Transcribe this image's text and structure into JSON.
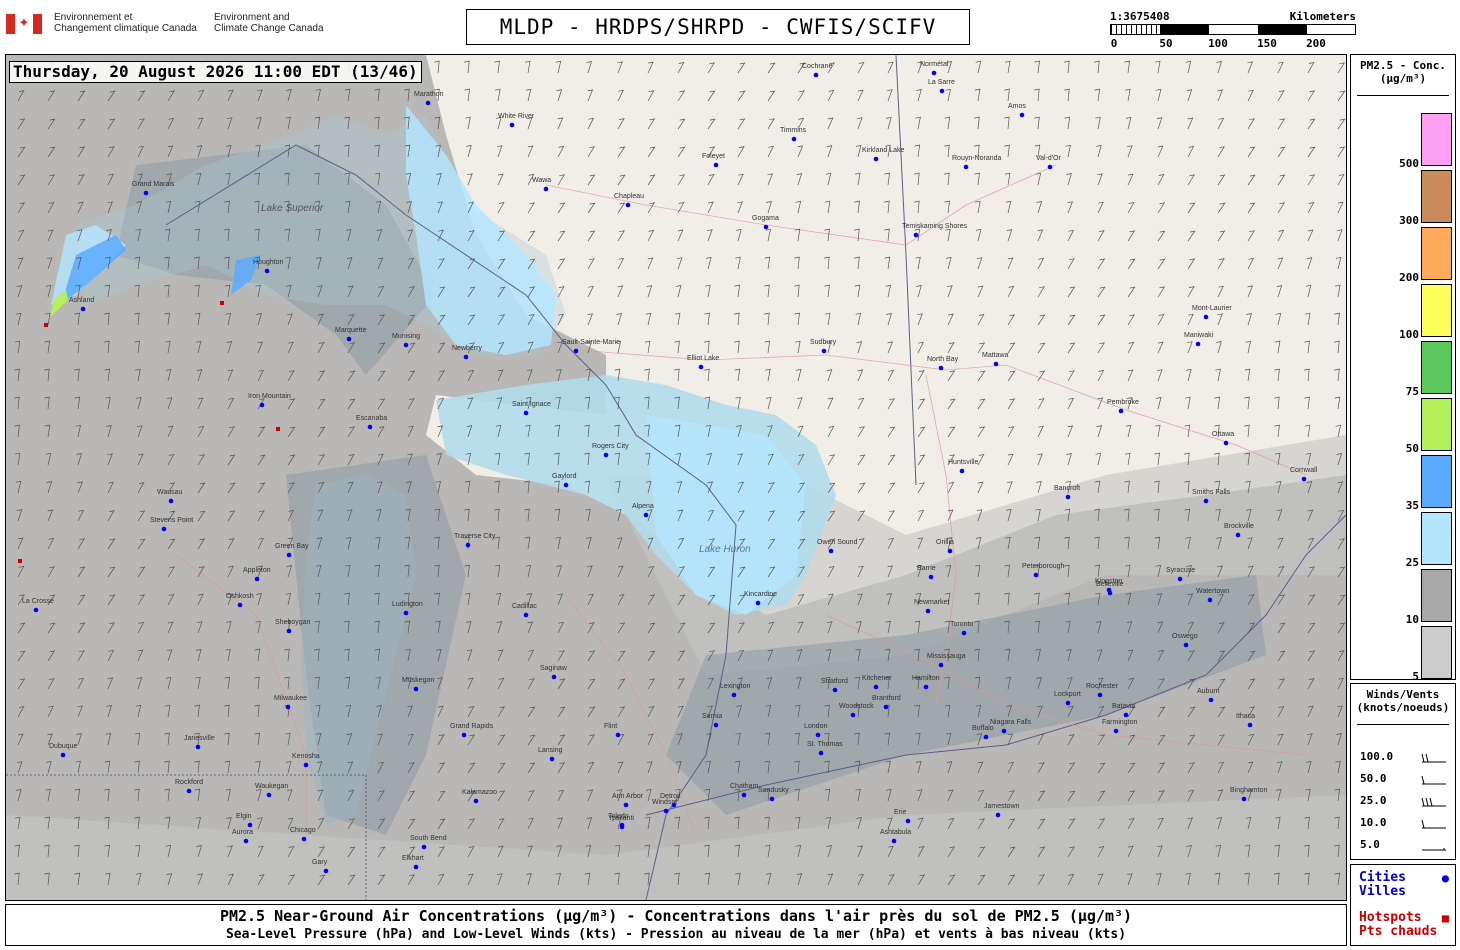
{
  "header": {
    "dept_fr_line1": "Environnement et",
    "dept_fr_line2": "Changement climatique Canada",
    "dept_en_line1": "Environment and",
    "dept_en_line2": "Climate Change Canada",
    "title": "MLDP - HRDPS/SHRPD - CWFIS/SCIFV",
    "scale_ratio": "1:3675408",
    "scale_unit": "Kilometers",
    "scale_ticks": [
      "0",
      "50",
      "100",
      "150",
      "200"
    ]
  },
  "map": {
    "timestamp": "Thursday, 20 August 2026 11:00 EDT (13/46)",
    "lake_labels": [
      "Lake Superior",
      "Lake Huron"
    ],
    "cities": [
      "Cochrane",
      "Normétal",
      "La Sarre",
      "Amos",
      "Val-d'Or",
      "Rouyn-Noranda",
      "Kirkland Lake",
      "Timmins",
      "Foleyet",
      "White River",
      "Marathon",
      "Wawa",
      "Chapleau",
      "Gogama",
      "Temiskaming Shores",
      "Sault-Sainte-Marie",
      "Elliot Lake",
      "Sudbury",
      "North Bay",
      "Mattawa",
      "Maniwaki",
      "Mont-Laurier",
      "Pembroke",
      "Ottawa",
      "Cornwall",
      "Huntsville",
      "Bancroft",
      "Smiths Falls",
      "Brockville",
      "Orillia",
      "Barrie",
      "Peterborough",
      "Belleville",
      "Newmarket",
      "Toronto",
      "Mississauga",
      "Hamilton",
      "Owen Sound",
      "Kincardine",
      "Stratford",
      "Kitchener",
      "Brantford",
      "Woodstock",
      "London",
      "St. Thomas",
      "Chatham",
      "Sarnia",
      "Detroit",
      "Windsor",
      "Lexington",
      "Saginaw",
      "Flint",
      "Lansing",
      "Grand Rapids",
      "Kalamazoo",
      "Muskegon",
      "Milwaukee",
      "Chicago",
      "Green Bay",
      "Appleton",
      "Oshkosh",
      "Sheboygan",
      "Escanaba",
      "Marquette",
      "Munising",
      "Newberry",
      "Saint Ignace",
      "Gaylord",
      "Rogers City",
      "Alpena",
      "Traverse City",
      "Cadillac",
      "Ludington",
      "Iron Mountain",
      "Ashland",
      "Houghton",
      "Grand Marais",
      "Wausau",
      "Stevens Point",
      "La Crosse",
      "Rockford",
      "Dubuque",
      "Janesville",
      "Waukegan",
      "Kenosha",
      "Elgin",
      "Aurora",
      "Gary",
      "South Bend",
      "Elkhart",
      "Toledo",
      "Ann Arbor",
      "Ypsilanti",
      "Sandusky",
      "Erie",
      "Buffalo",
      "Niagara Falls",
      "Rochester",
      "Syracuse",
      "Watertown",
      "Kingston",
      "Binghamton",
      "Jamestown",
      "Ashtabula",
      "Lockport",
      "Batavia",
      "Farmington",
      "Oswego",
      "Auburn",
      "Ithaca"
    ]
  },
  "legend": {
    "title_line1": "PM2.5 - Conc.",
    "title_line2": "(µg/m³)",
    "levels": [
      {
        "label": "500",
        "color": "#ffa0f5"
      },
      {
        "label": "300",
        "color": "#c98b5a"
      },
      {
        "label": "200",
        "color": "#ffaa5a"
      },
      {
        "label": "100",
        "color": "#ffff5a"
      },
      {
        "label": "75",
        "color": "#5ac85a"
      },
      {
        "label": "50",
        "color": "#b4f05a"
      },
      {
        "label": "35",
        "color": "#5aaaff"
      },
      {
        "label": "25",
        "color": "#b4e6ff"
      },
      {
        "label": "10",
        "color": "#a8a8a8"
      },
      {
        "label": "5",
        "color": "#cccccc"
      }
    ]
  },
  "winds": {
    "title_line1": "Winds/Vents",
    "title_line2": "(knots/noeuds)",
    "rows": [
      {
        "label": "100.0",
        "barbs": 2
      },
      {
        "label": "50.0",
        "barbs": 1
      },
      {
        "label": "25.0",
        "barbs": 3
      },
      {
        "label": "10.0",
        "barbs": 1
      },
      {
        "label": "5.0",
        "barbs": 0
      }
    ]
  },
  "key": {
    "cities_en": "Cities",
    "cities_fr": "Villes",
    "hotspots_en": "Hotspots",
    "hotspots_fr": "Pts chauds",
    "city_color": "#0000ff",
    "hotspot_color": "#cc0000"
  },
  "footer": {
    "line1": "PM2.5 Near-Ground Air Concentrations (µg/m³) - Concentrations dans l'air près du sol de PM2.5 (µg/m³)",
    "line2": "Sea-Level Pressure (hPa) and Low-Level Winds (kts) - Pression au niveau de la mer (hPa) et vents à bas niveau (kts)"
  }
}
